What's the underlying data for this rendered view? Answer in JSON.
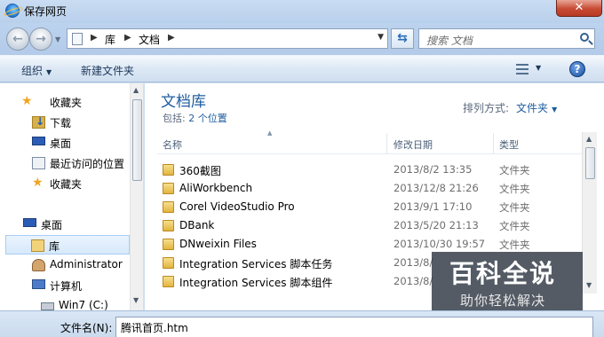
{
  "window": {
    "title": "保存网页",
    "close_glyph": "✕"
  },
  "address": {
    "crumbs": [
      "库",
      "文档"
    ],
    "search_placeholder": "搜索 文档"
  },
  "toolbar": {
    "organize": "组织",
    "new_folder": "新建文件夹",
    "help_glyph": "?"
  },
  "nav": {
    "favorites": [
      {
        "label": "收藏夹",
        "icon": "favorites-star-icon"
      },
      {
        "label": "下载",
        "icon": "downloads-folder-icon"
      },
      {
        "label": "桌面",
        "icon": "desktop-icon"
      },
      {
        "label": "最近访问的位置",
        "icon": "recent-places-icon"
      },
      {
        "label": "收藏夹",
        "icon": "favorites-star-icon"
      }
    ],
    "tree": [
      {
        "label": "桌面",
        "icon": "desktop-icon"
      },
      {
        "label": "库",
        "icon": "library-icon",
        "selected": true
      },
      {
        "label": "Administrator",
        "icon": "user-folder-icon"
      },
      {
        "label": "计算机",
        "icon": "computer-icon"
      },
      {
        "label": "Win7 (C:)",
        "icon": "drive-icon"
      }
    ]
  },
  "library": {
    "title": "文档库",
    "includes_prefix": "包括:",
    "includes_link": "2 个位置",
    "arrange_label": "排列方式:",
    "arrange_value": "文件夹"
  },
  "columns": {
    "name": "名称",
    "date": "修改日期",
    "type": "类型"
  },
  "files": [
    {
      "name": "360截图",
      "date": "2013/8/2 13:35",
      "type": "文件夹"
    },
    {
      "name": "AliWorkbench",
      "date": "2013/12/8 21:26",
      "type": "文件夹"
    },
    {
      "name": "Corel VideoStudio Pro",
      "date": "2013/9/1 17:10",
      "type": "文件夹"
    },
    {
      "name": "DBank",
      "date": "2013/5/20 21:13",
      "type": "文件夹"
    },
    {
      "name": "DNweixin Files",
      "date": "2013/10/30 19:57",
      "type": "文件夹"
    },
    {
      "name": "Integration Services 脚本任务",
      "date": "2013/8/",
      "type": ""
    },
    {
      "name": "Integration Services 脚本组件",
      "date": "2013/8/",
      "type": ""
    }
  ],
  "watermark": {
    "title": "百科全说",
    "subtitle": "助你轻松解决"
  },
  "save": {
    "filename_label": "文件名(N):",
    "filename_value": "腾讯首页.htm"
  }
}
